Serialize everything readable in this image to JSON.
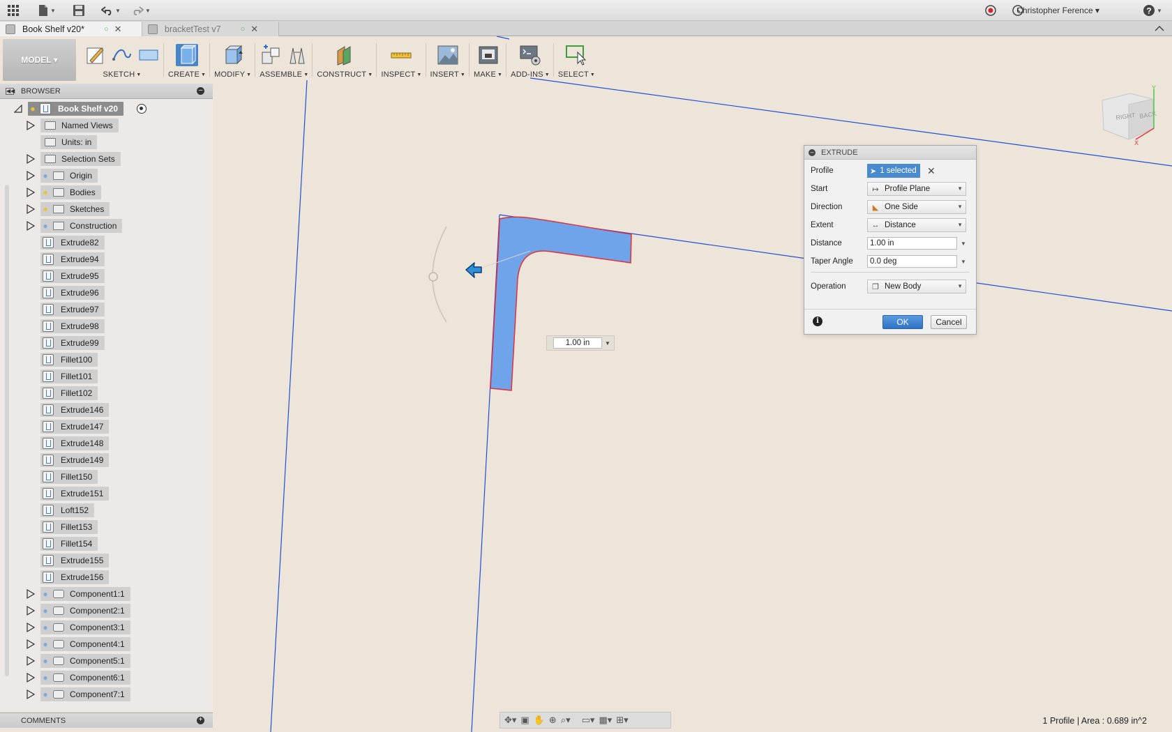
{
  "app": {
    "user_name": "Christopher Ference ▾",
    "help": "?"
  },
  "tabs": [
    {
      "label": "Book Shelf v20*",
      "active": true
    },
    {
      "label": "bracketTest v7",
      "active": false
    }
  ],
  "toolbar": {
    "workspace": "MODEL ▾",
    "groups": [
      {
        "label": "SKETCH"
      },
      {
        "label": "CREATE"
      },
      {
        "label": "MODIFY"
      },
      {
        "label": "ASSEMBLE"
      },
      {
        "label": "CONSTRUCT"
      },
      {
        "label": "INSPECT"
      },
      {
        "label": "INSERT"
      },
      {
        "label": "MAKE"
      },
      {
        "label": "ADD-INS"
      },
      {
        "label": "SELECT"
      }
    ]
  },
  "browser": {
    "title": "BROWSER",
    "root": "Book Shelf v20",
    "folders": [
      {
        "label": "Named Views"
      },
      {
        "label": "Units: in"
      },
      {
        "label": "Selection Sets"
      },
      {
        "label": "Origin"
      },
      {
        "label": "Bodies"
      },
      {
        "label": "Sketches"
      },
      {
        "label": "Construction"
      }
    ],
    "features": [
      "Extrude82",
      "Extrude94",
      "Extrude95",
      "Extrude96",
      "Extrude97",
      "Extrude98",
      "Extrude99",
      "Fillet100",
      "Fillet101",
      "Fillet102",
      "Extrude146",
      "Extrude147",
      "Extrude148",
      "Extrude149",
      "Fillet150",
      "Extrude151",
      "Loft152",
      "Fillet153",
      "Fillet154",
      "Extrude155",
      "Extrude156"
    ],
    "components": [
      "Component1:1",
      "Component2:1",
      "Component3:1",
      "Component4:1",
      "Component5:1",
      "Component6:1",
      "Component7:1"
    ]
  },
  "comments": {
    "title": "COMMENTS"
  },
  "extrude_dialog": {
    "title": "EXTRUDE",
    "profile_label": "Profile",
    "profile_value": "1 selected",
    "start_label": "Start",
    "start_value": "Profile Plane",
    "direction_label": "Direction",
    "direction_value": "One Side",
    "extent_label": "Extent",
    "extent_value": "Distance",
    "distance_label": "Distance",
    "distance_value": "1.00 in",
    "taper_label": "Taper Angle",
    "taper_value": "0.0 deg",
    "operation_label": "Operation",
    "operation_value": "New Body",
    "ok": "OK",
    "cancel": "Cancel"
  },
  "canvas": {
    "distance_field": "1.00 in",
    "viewcube_right": "RIGHT",
    "viewcube_back": "BACK",
    "axis_y": "Y",
    "axis_x": "X"
  },
  "status": "1 Profile | Area : 0.689 in^2",
  "colors": {
    "accent": "#4a8bd0",
    "profile_fill": "#6fa4ea",
    "profile_edge": "#e0303a",
    "sketch_line": "#1f4fd8",
    "canvas_bg": "#ede5da"
  }
}
